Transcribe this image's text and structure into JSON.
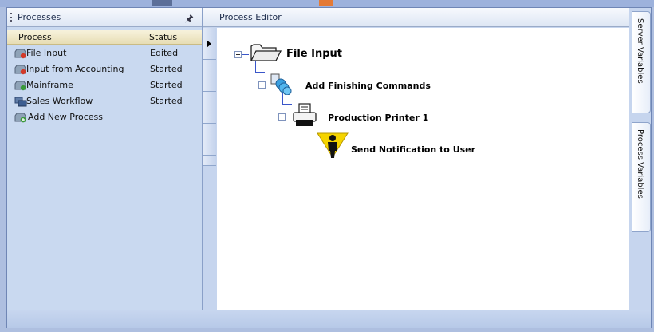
{
  "processes_panel": {
    "title": "Processes",
    "pin_icon": "pin-icon",
    "columns": {
      "process": "Process",
      "status": "Status"
    },
    "rows": [
      {
        "name": "File Input",
        "status": "Edited",
        "icon": "process-red-icon"
      },
      {
        "name": "Input from Accounting",
        "status": "Started",
        "icon": "process-red-icon"
      },
      {
        "name": "Mainframe",
        "status": "Started",
        "icon": "process-green-icon"
      },
      {
        "name": "Sales Workflow",
        "status": "Started",
        "icon": "workflow-icon"
      }
    ],
    "add_new": {
      "label": "Add New Process",
      "icon": "add-process-icon"
    }
  },
  "editor": {
    "title": "Process Editor",
    "nodes": [
      {
        "label": "File Input",
        "icon": "folder-icon"
      },
      {
        "label": "Add Finishing Commands",
        "icon": "finishing-commands-icon"
      },
      {
        "label": "Production Printer 1",
        "icon": "printer-icon"
      },
      {
        "label": "Send Notification to User",
        "icon": "user-notification-icon"
      }
    ]
  },
  "side_tabs": {
    "server_variables": "Server Variables",
    "process_variables": "Process Variables"
  },
  "colors": {
    "tree_line": "#3a56c9",
    "panel_bg": "#c9d9f0",
    "accent_red": "#d23a2a",
    "accent_green": "#3a9a3a"
  }
}
